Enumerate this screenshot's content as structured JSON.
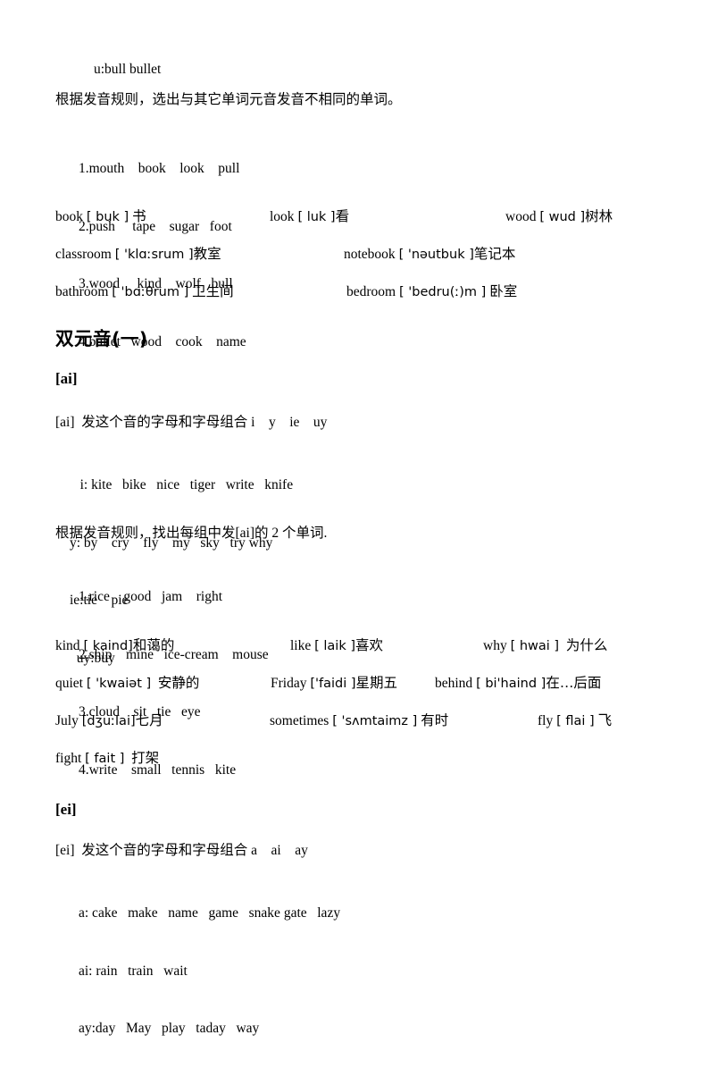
{
  "document": {
    "type": "english-phonetics-worksheet",
    "background": "#ffffff",
    "text_color": "#000000"
  },
  "top_section": {
    "rule_line": "u:bull bullet",
    "instruction": "根据发音规则，选出与其它单词元音发音不相同的单词。",
    "questions": [
      "1.mouth    book    look    pull",
      "2.push     tape    sugar   foot",
      "3.wood     kind    wolf   bull",
      "4.bullet   wood    cook    name"
    ],
    "vocab_rows": [
      {
        "cells": [
          {
            "word": "book",
            "ipa": "[ buk ]",
            "gloss": "书"
          },
          {
            "word": "look",
            "ipa": "[ luk ]",
            "gloss": "看"
          },
          {
            "word": "wood",
            "ipa": "[ wud ]",
            "gloss": "树林"
          }
        ]
      },
      {
        "cells": [
          {
            "word": "classroom",
            "ipa": "[ 'klɑːsrum ]",
            "gloss": "教室"
          },
          {
            "word": "notebook",
            "ipa": "[ 'nəutbuk ]",
            "gloss": "笔记本"
          }
        ]
      },
      {
        "cells": [
          {
            "word": "bathroom",
            "ipa": "[ 'bɑːθrum ]",
            "gloss": "卫生间"
          },
          {
            "word": "bedroom",
            "ipa": "[ 'bedru(ː)m ]",
            "gloss": "卧室"
          }
        ]
      }
    ]
  },
  "diphthong_section": {
    "title": "双元音(一)"
  },
  "ai_section": {
    "heading": "[ai]",
    "rule_intro": "[ai]  发这个音的字母和字母组合 i    y    ie    uy",
    "letter_examples": [
      "   i: kite   bike   nice   tiger   write   knife",
      "y: by    cry    fly    my   sky   try why",
      "ie:tie    pie",
      "  uy:buy"
    ],
    "exercise_instruction": "根据发音规则，找出每组中发[ai]的 2 个单词.",
    "questions": [
      "1.rice    good   jam    right",
      "2.ship    mine   ice-cream    mouse",
      "3.cloud    sit   tie   eye",
      "4.write    small   tennis   kite"
    ],
    "vocab_rows": [
      {
        "cells": [
          {
            "word": "kind",
            "ipa": "[ kaind]",
            "gloss": "和蔼的"
          },
          {
            "word": "like",
            "ipa": "[ laik ]",
            "gloss": "喜欢"
          },
          {
            "word": "why",
            "ipa": "[ hwai ]",
            "gloss": "为什么"
          }
        ]
      },
      {
        "cells": [
          {
            "word": "quiet",
            "ipa": "[ 'kwaiət ]",
            "gloss": "安静的"
          },
          {
            "word": "Friday",
            "ipa": "['faidi ]",
            "gloss": "星期五"
          },
          {
            "word": "behind",
            "ipa": "[ bi'haind ]",
            "gloss": "在…后面"
          }
        ]
      },
      {
        "cells": [
          {
            "word": "July",
            "ipa": "[dʒuːlai]",
            "gloss": "七月"
          },
          {
            "word": "sometimes",
            "ipa": "[ 'sʌmtaimz ]",
            "gloss": "有时"
          },
          {
            "word": "fly",
            "ipa": "[ flai ]",
            "gloss": "飞"
          }
        ]
      },
      {
        "cells": [
          {
            "word": "fight",
            "ipa": "[ fait ]",
            "gloss": "打架"
          }
        ]
      }
    ]
  },
  "ei_section": {
    "heading": "[ei]",
    "rule_intro": "[ei]  发这个音的字母和字母组合 a    ai    ay",
    "letter_examples": [
      "a: cake   make   name   game   snake gate   lazy",
      "ai: rain   train   wait",
      "ay:day   May   play   taday   way"
    ]
  }
}
